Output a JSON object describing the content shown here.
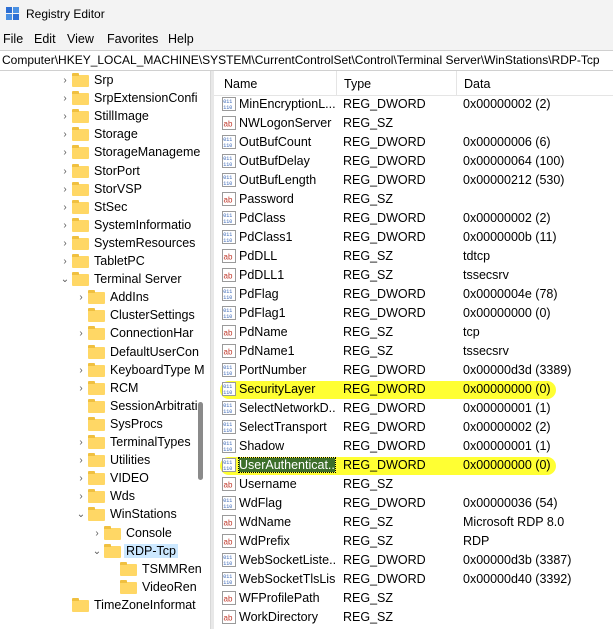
{
  "window": {
    "title": "Registry Editor"
  },
  "menu": [
    "File",
    "Edit",
    "View",
    "Favorites",
    "Help"
  ],
  "address": "Computer\\HKEY_LOCAL_MACHINE\\SYSTEM\\CurrentControlSet\\Control\\Terminal Server\\WinStations\\RDP-Tcp",
  "tree": [
    {
      "label": "Srp",
      "level": 0,
      "expander": ">"
    },
    {
      "label": "SrpExtensionConfi",
      "level": 0,
      "expander": ">"
    },
    {
      "label": "StillImage",
      "level": 0,
      "expander": ">"
    },
    {
      "label": "Storage",
      "level": 0,
      "expander": ">"
    },
    {
      "label": "StorageManageme",
      "level": 0,
      "expander": ">"
    },
    {
      "label": "StorPort",
      "level": 0,
      "expander": ">"
    },
    {
      "label": "StorVSP",
      "level": 0,
      "expander": ">"
    },
    {
      "label": "StSec",
      "level": 0,
      "expander": ">"
    },
    {
      "label": "SystemInformatio",
      "level": 0,
      "expander": ">"
    },
    {
      "label": "SystemResources",
      "level": 0,
      "expander": ">"
    },
    {
      "label": "TabletPC",
      "level": 0,
      "expander": ">"
    },
    {
      "label": "Terminal Server",
      "level": 0,
      "expander": "v"
    },
    {
      "label": "AddIns",
      "level": 1,
      "expander": ">"
    },
    {
      "label": "ClusterSettings",
      "level": 1,
      "expander": ""
    },
    {
      "label": "ConnectionHar",
      "level": 1,
      "expander": ">"
    },
    {
      "label": "DefaultUserCon",
      "level": 1,
      "expander": ""
    },
    {
      "label": "KeyboardType M",
      "level": 1,
      "expander": ">"
    },
    {
      "label": "RCM",
      "level": 1,
      "expander": ">"
    },
    {
      "label": "SessionArbitrati",
      "level": 1,
      "expander": ""
    },
    {
      "label": "SysProcs",
      "level": 1,
      "expander": ""
    },
    {
      "label": "TerminalTypes",
      "level": 1,
      "expander": ">"
    },
    {
      "label": "Utilities",
      "level": 1,
      "expander": ">"
    },
    {
      "label": "VIDEO",
      "level": 1,
      "expander": ">"
    },
    {
      "label": "Wds",
      "level": 1,
      "expander": ">"
    },
    {
      "label": "WinStations",
      "level": 1,
      "expander": "v"
    },
    {
      "label": "Console",
      "level": 2,
      "expander": ">"
    },
    {
      "label": "RDP-Tcp",
      "level": 2,
      "expander": "v",
      "selected": true
    },
    {
      "label": "TSMMRen",
      "level": 3,
      "expander": ""
    },
    {
      "label": "VideoRen",
      "level": 3,
      "expander": ""
    },
    {
      "label": "TimeZoneInformat",
      "level": 0,
      "expander": ""
    }
  ],
  "list": {
    "columns": [
      "Name",
      "Type",
      "Data"
    ],
    "rows": [
      {
        "name": "MinEncryptionL...",
        "type": "REG_DWORD",
        "data": "0x00000002 (2)",
        "icon": "dword"
      },
      {
        "name": "NWLogonServer",
        "type": "REG_SZ",
        "data": "",
        "icon": "sz"
      },
      {
        "name": "OutBufCount",
        "type": "REG_DWORD",
        "data": "0x00000006 (6)",
        "icon": "dword"
      },
      {
        "name": "OutBufDelay",
        "type": "REG_DWORD",
        "data": "0x00000064 (100)",
        "icon": "dword"
      },
      {
        "name": "OutBufLength",
        "type": "REG_DWORD",
        "data": "0x00000212 (530)",
        "icon": "dword"
      },
      {
        "name": "Password",
        "type": "REG_SZ",
        "data": "",
        "icon": "sz"
      },
      {
        "name": "PdClass",
        "type": "REG_DWORD",
        "data": "0x00000002 (2)",
        "icon": "dword"
      },
      {
        "name": "PdClass1",
        "type": "REG_DWORD",
        "data": "0x0000000b (11)",
        "icon": "dword"
      },
      {
        "name": "PdDLL",
        "type": "REG_SZ",
        "data": "tdtcp",
        "icon": "sz"
      },
      {
        "name": "PdDLL1",
        "type": "REG_SZ",
        "data": "tssecsrv",
        "icon": "sz"
      },
      {
        "name": "PdFlag",
        "type": "REG_DWORD",
        "data": "0x0000004e (78)",
        "icon": "dword"
      },
      {
        "name": "PdFlag1",
        "type": "REG_DWORD",
        "data": "0x00000000 (0)",
        "icon": "dword"
      },
      {
        "name": "PdName",
        "type": "REG_SZ",
        "data": "tcp",
        "icon": "sz"
      },
      {
        "name": "PdName1",
        "type": "REG_SZ",
        "data": "tssecsrv",
        "icon": "sz"
      },
      {
        "name": "PortNumber",
        "type": "REG_DWORD",
        "data": "0x00000d3d (3389)",
        "icon": "dword"
      },
      {
        "name": "SecurityLayer",
        "type": "REG_DWORD",
        "data": "0x00000000 (0)",
        "icon": "dword",
        "highlight": true
      },
      {
        "name": "SelectNetworkD...",
        "type": "REG_DWORD",
        "data": "0x00000001 (1)",
        "icon": "dword"
      },
      {
        "name": "SelectTransport",
        "type": "REG_DWORD",
        "data": "0x00000002 (2)",
        "icon": "dword"
      },
      {
        "name": "Shadow",
        "type": "REG_DWORD",
        "data": "0x00000001 (1)",
        "icon": "dword"
      },
      {
        "name": "UserAuthenticat...",
        "type": "REG_DWORD",
        "data": "0x00000000 (0)",
        "icon": "dword",
        "highlight": true,
        "focused": true
      },
      {
        "name": "Username",
        "type": "REG_SZ",
        "data": "",
        "icon": "sz"
      },
      {
        "name": "WdFlag",
        "type": "REG_DWORD",
        "data": "0x00000036 (54)",
        "icon": "dword"
      },
      {
        "name": "WdName",
        "type": "REG_SZ",
        "data": "Microsoft RDP 8.0",
        "icon": "sz"
      },
      {
        "name": "WdPrefix",
        "type": "REG_SZ",
        "data": "RDP",
        "icon": "sz"
      },
      {
        "name": "WebSocketListe...",
        "type": "REG_DWORD",
        "data": "0x00000d3b (3387)",
        "icon": "dword"
      },
      {
        "name": "WebSocketTlsLis...",
        "type": "REG_DWORD",
        "data": "0x00000d40 (3392)",
        "icon": "dword"
      },
      {
        "name": "WFProfilePath",
        "type": "REG_SZ",
        "data": "",
        "icon": "sz"
      },
      {
        "name": "WorkDirectory",
        "type": "REG_SZ",
        "data": "",
        "icon": "sz"
      }
    ]
  },
  "colors": {
    "highlight": "#ffff33",
    "selection": "#cce8ff",
    "folder": "#ffd765",
    "sz_icon": "#c0392b",
    "dword_icon": "#2f5fb3"
  }
}
